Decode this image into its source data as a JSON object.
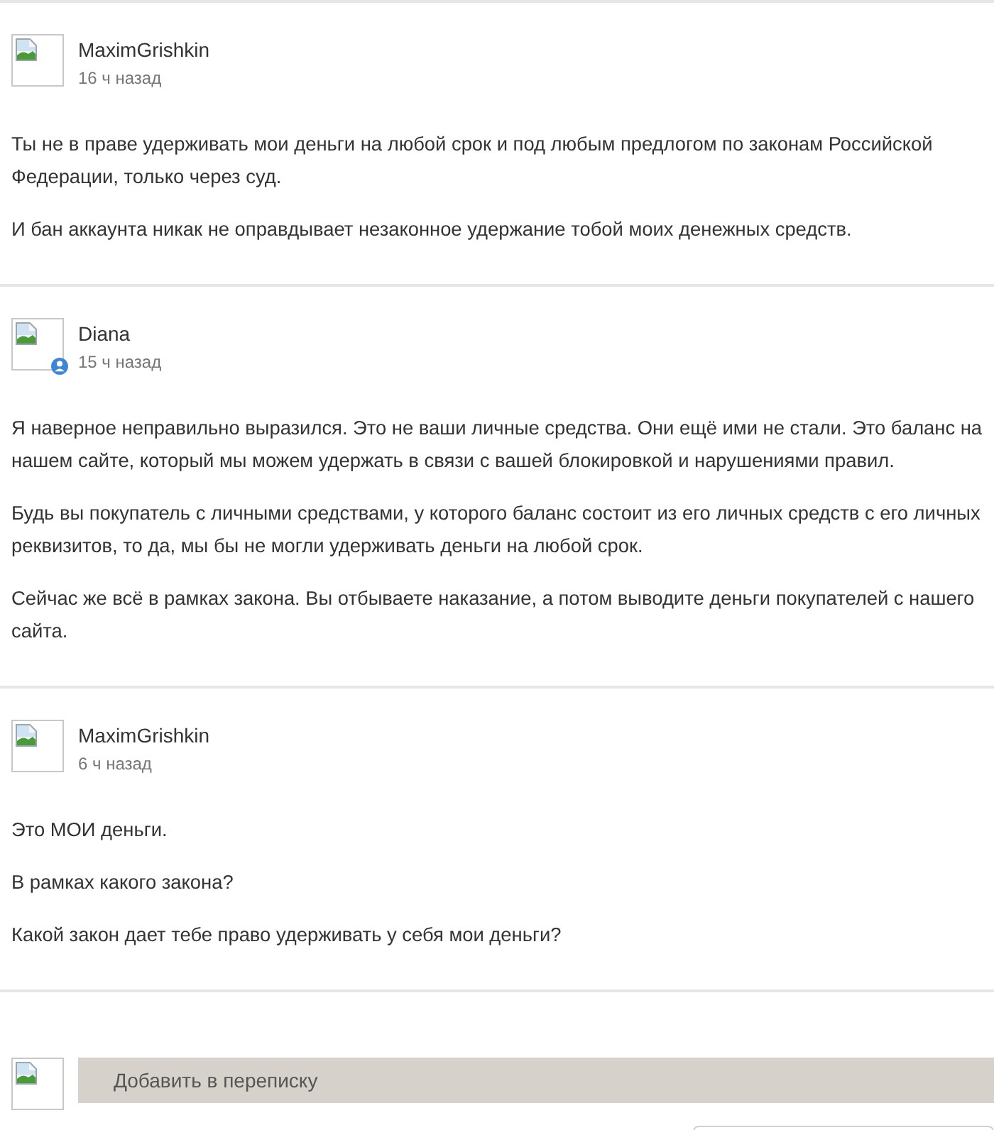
{
  "messages": [
    {
      "author": "MaximGrishkin",
      "time": "16 ч назад",
      "badge": false,
      "paragraphs": [
        "Ты не в праве удерживать мои деньги на любой срок и под любым предлогом по законам Российской Федерации, только через суд.",
        "И бан аккаунта никак не оправдывает незаконное удержание тобой моих денежных средств."
      ]
    },
    {
      "author": "Diana",
      "time": "15 ч назад",
      "badge": true,
      "paragraphs": [
        "Я наверное неправильно выразился. Это не ваши личные средства. Они ещё ими не стали. Это баланс на нашем сайте, который мы можем удержать в связи с вашей блокировкой и нарушениями правил.",
        "Будь вы покупатель с личными средствами, у которого баланс состоит из его личных средств с его личных реквизитов, то да, мы бы не могли удерживать деньги на любой срок.",
        "Сейчас же всё в рамках закона. Вы отбываете наказание, а потом выводите деньги покупателей с нашего сайта."
      ]
    },
    {
      "author": "MaximGrishkin",
      "time": "6 ч назад",
      "badge": false,
      "paragraphs": [
        "Это МОИ деньги.",
        "В рамках какого закона?",
        "Какой закон дает тебе право удерживать у себя мои деньги?"
      ]
    }
  ],
  "reply": {
    "placeholder": "Добавить в переписку"
  }
}
